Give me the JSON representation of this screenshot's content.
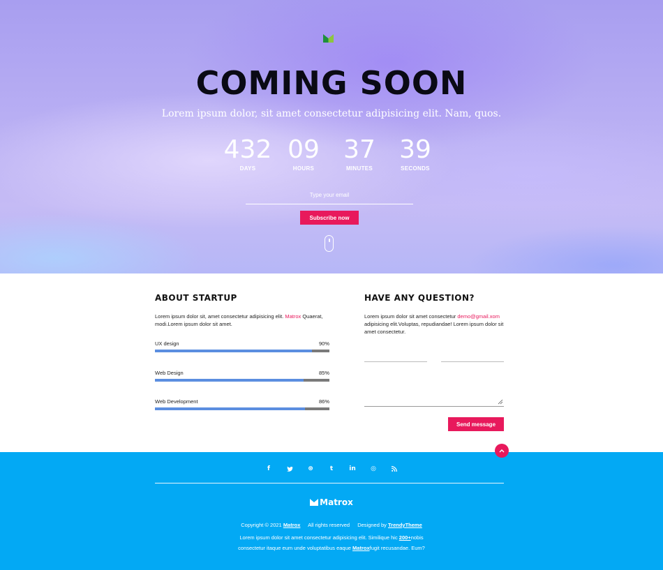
{
  "hero": {
    "title": "COMING SOON",
    "subtitle": "Lorem ipsum dolor, sit amet consectetur adipisicing elit. Nam, quos.",
    "countdown": [
      {
        "value": "432",
        "label": "DAYS"
      },
      {
        "value": "09",
        "label": "HOURS"
      },
      {
        "value": "37",
        "label": "MINUTES"
      },
      {
        "value": "39",
        "label": "SECONDS"
      }
    ],
    "email_placeholder": "Type your email",
    "subscribe_label": "Subscribe now"
  },
  "about": {
    "title": "ABOUT STARTUP",
    "text_before": "Lorem ipsum dolor sit, amet consectetur adipisicing elit. ",
    "text_highlight": "Matrox",
    "text_after": " Quaerat, modi.Lorem ipsum dolor sit amet.",
    "skills": [
      {
        "name": "UX design",
        "percent_label": "90%",
        "value": 0.9
      },
      {
        "name": "Web Design",
        "percent_label": "85%",
        "value": 0.85
      },
      {
        "name": "Web Development",
        "percent_label": "86%",
        "value": 0.86
      }
    ]
  },
  "question": {
    "title": "HAVE ANY QUESTION?",
    "text_before": "Lorem ipsum dolor sit amet consectetur ",
    "email": "demo@gmail.xom",
    "text_after": " adipisicing elit.Voluptas, repudiandae! Lorem ipsum dolor sit amet consectetur.",
    "send_label": "Send message"
  },
  "footer": {
    "socials": [
      {
        "icon": "facebook-icon",
        "glyph": "f"
      },
      {
        "icon": "twitter-icon",
        "glyph": "🐦"
      },
      {
        "icon": "dribbble-icon",
        "glyph": "⊛"
      },
      {
        "icon": "tumblr-icon",
        "glyph": "t"
      },
      {
        "icon": "linkedin-icon",
        "glyph": "in"
      },
      {
        "icon": "instagram-icon",
        "glyph": "◎"
      },
      {
        "icon": "rss-icon",
        "glyph": "◝"
      }
    ],
    "brand": "Matrox",
    "copyright": "Copyright © 2021",
    "copyright_brand": "Matrox",
    "rights": "All rights reserved",
    "designed_by": "Designed by",
    "designer": "TrendyTheme",
    "desc_1a": "Lorem ipsum dolor sit amet consectetur adipisicing elit. Similique hic ",
    "desc_1link": "200+",
    "desc_1b": "nobis",
    "desc_2a": "consectetur itaque eum unde voluptatibus eaque ",
    "desc_2link": "Matrox",
    "desc_2b": "fugit recusandae. Eum?"
  },
  "colors": {
    "accent": "#e8195c",
    "footer": "#03a9f4",
    "bar": "#5b8ee0",
    "bar_track": "#7a7a7a"
  }
}
